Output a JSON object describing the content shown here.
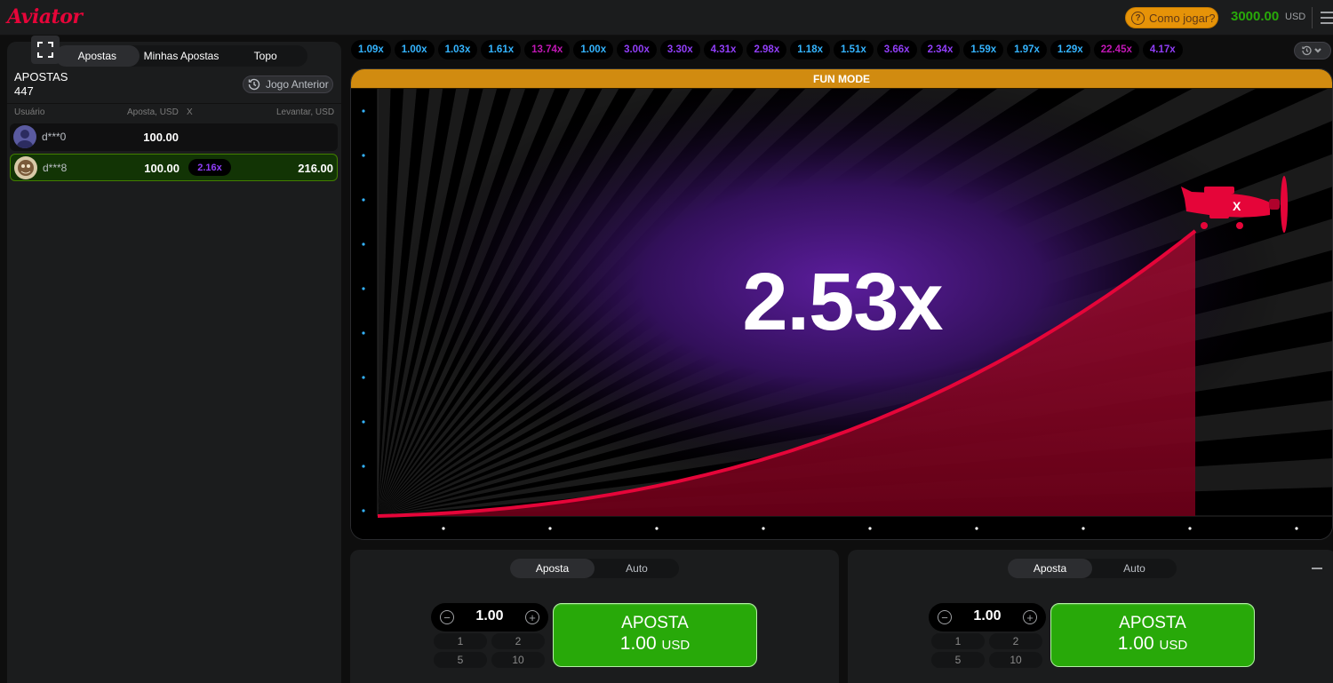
{
  "header": {
    "logo": "Aviator",
    "how_to_play": "Como jogar?",
    "balance": "3000.00",
    "currency": "USD"
  },
  "left_panel": {
    "tabs": [
      "Apostas",
      "Minhas Apostas",
      "Topo"
    ],
    "active_tab": "Apostas",
    "bets_title": "APOSTAS",
    "bets_count": "447",
    "previous_game": "Jogo Anterior",
    "columns": {
      "user": "Usuário",
      "bet": "Aposta, USD",
      "mult": "X",
      "cashout": "Levantar, USD"
    },
    "rows": [
      {
        "user": "d***0",
        "bet": "100.00",
        "mult": "",
        "cashout": "",
        "won": false
      },
      {
        "user": "d***8",
        "bet": "100.00",
        "mult": "2.16x",
        "cashout": "216.00",
        "won": true
      }
    ]
  },
  "history": [
    {
      "v": "1.09x",
      "c": "#34b4ff"
    },
    {
      "v": "1.00x",
      "c": "#34b4ff"
    },
    {
      "v": "1.03x",
      "c": "#34b4ff"
    },
    {
      "v": "1.61x",
      "c": "#34b4ff"
    },
    {
      "v": "13.74x",
      "c": "#c017b4"
    },
    {
      "v": "1.00x",
      "c": "#34b4ff"
    },
    {
      "v": "3.00x",
      "c": "#913ef8"
    },
    {
      "v": "3.30x",
      "c": "#913ef8"
    },
    {
      "v": "4.31x",
      "c": "#913ef8"
    },
    {
      "v": "2.98x",
      "c": "#913ef8"
    },
    {
      "v": "1.18x",
      "c": "#34b4ff"
    },
    {
      "v": "1.51x",
      "c": "#34b4ff"
    },
    {
      "v": "3.66x",
      "c": "#913ef8"
    },
    {
      "v": "2.34x",
      "c": "#913ef8"
    },
    {
      "v": "1.59x",
      "c": "#34b4ff"
    },
    {
      "v": "1.97x",
      "c": "#34b4ff"
    },
    {
      "v": "1.29x",
      "c": "#34b4ff"
    },
    {
      "v": "22.45x",
      "c": "#c017b4"
    },
    {
      "v": "4.17x",
      "c": "#913ef8"
    }
  ],
  "game": {
    "mode_banner": "FUN MODE",
    "multiplier": "2.53x",
    "curve_color": "#e50539",
    "accent_purple": "#5b1d9c"
  },
  "bet_panels": [
    {
      "tabs": [
        "Aposta",
        "Auto"
      ],
      "amount": "1.00",
      "quick": [
        "1",
        "2",
        "5",
        "10"
      ],
      "button_line1": "APOSTA",
      "button_amount": "1.00",
      "button_currency": "USD"
    },
    {
      "tabs": [
        "Aposta",
        "Auto"
      ],
      "amount": "1.00",
      "quick": [
        "1",
        "2",
        "5",
        "10"
      ],
      "button_line1": "APOSTA",
      "button_amount": "1.00",
      "button_currency": "USD"
    }
  ]
}
